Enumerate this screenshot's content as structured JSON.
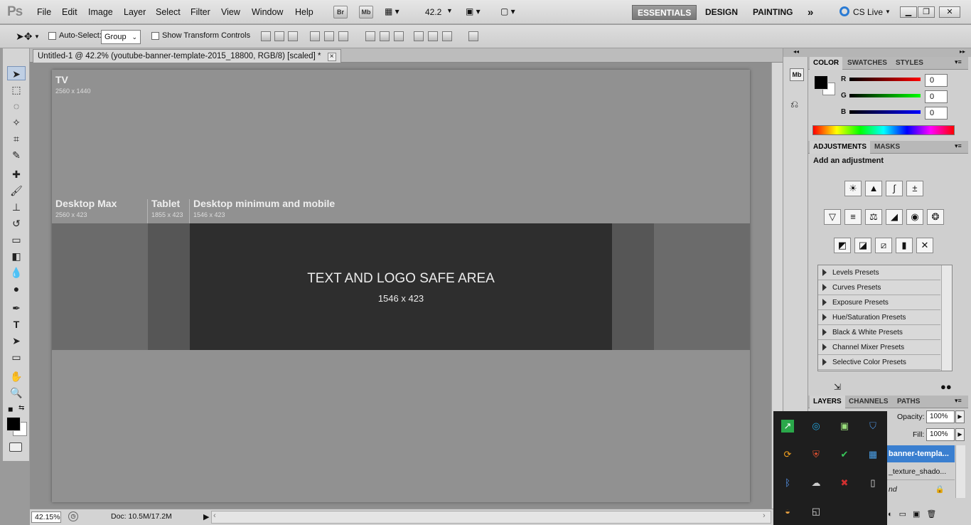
{
  "app": {
    "logo": "Ps"
  },
  "menu": [
    "File",
    "Edit",
    "Image",
    "Layer",
    "Select",
    "Filter",
    "View",
    "Window",
    "Help"
  ],
  "appbar": {
    "br": "Br",
    "mb": "Mb",
    "zoom": "42.2",
    "workspaces": [
      "ESSENTIALS",
      "DESIGN",
      "PAINTING"
    ],
    "more": "»",
    "cslive": "CS Live"
  },
  "options": {
    "auto_select_label": "Auto-Select:",
    "auto_select_value": "Group",
    "show_transform": "Show Transform Controls"
  },
  "document": {
    "tab_title": "Untitled-1 @ 42.2% (youtube-banner-template-2015_18800, RGB/8) [scaled] *",
    "close": "×"
  },
  "banner": {
    "tv_label": "TV",
    "tv_size": "2560 x 1440",
    "desktop_max_label": "Desktop Max",
    "desktop_max_size": "2560 x 423",
    "tablet_label": "Tablet",
    "tablet_size": "1855 x 423",
    "mobile_label": "Desktop minimum and mobile",
    "mobile_size": "1546 x 423",
    "safe_title": "TEXT AND LOGO SAFE AREA",
    "safe_size": "1546 x 423"
  },
  "status": {
    "zoom": "42.15%",
    "doc": "Doc: 10.5M/17.2M"
  },
  "panels": {
    "color_tabs": [
      "COLOR",
      "SWATCHES",
      "STYLES"
    ],
    "rgb": {
      "r_label": "R",
      "g_label": "G",
      "b_label": "B",
      "r": "0",
      "g": "0",
      "b": "0"
    },
    "adjust_tabs": [
      "ADJUSTMENTS",
      "MASKS"
    ],
    "add_adjustment": "Add an adjustment",
    "presets": [
      "Levels Presets",
      "Curves Presets",
      "Exposure Presets",
      "Hue/Saturation Presets",
      "Black & White Presets",
      "Channel Mixer Presets",
      "Selective Color Presets"
    ],
    "layer_tabs": [
      "LAYERS",
      "CHANNELS",
      "PATHS"
    ],
    "opacity_label": "Opacity:",
    "opacity": "100%",
    "fill_label": "Fill:",
    "fill": "100%",
    "layers": [
      "banner-templa...",
      "_texture_shado...",
      "nd"
    ]
  },
  "colors": {
    "accent": "#3a7fd0",
    "safe_area": "#2e2e2e",
    "canvas": "#919191"
  }
}
